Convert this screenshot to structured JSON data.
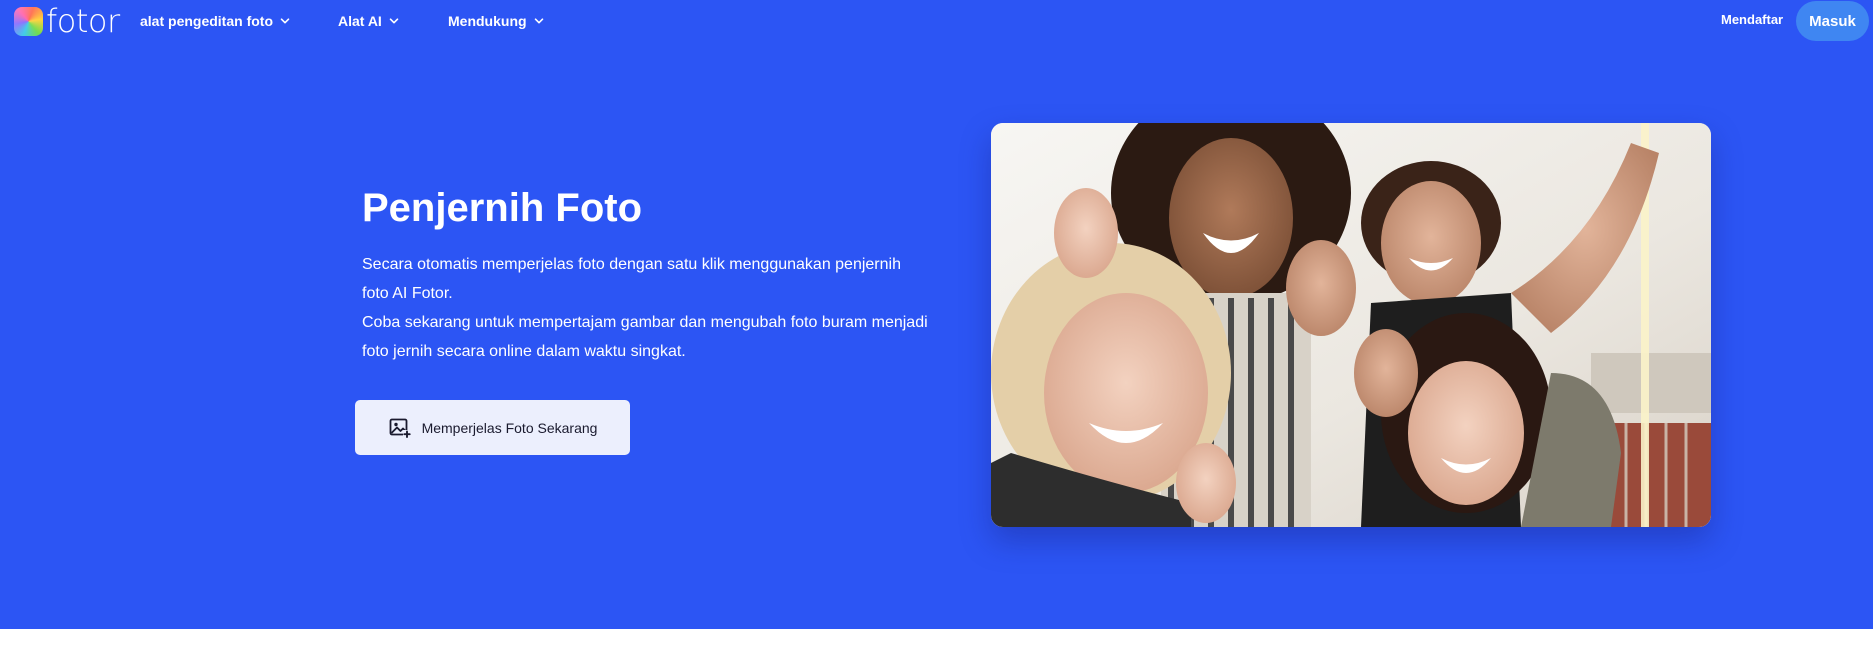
{
  "brand": {
    "name": "fotor",
    "logo_icon": "fotor-logo-icon"
  },
  "nav": {
    "items": [
      {
        "label": "alat pengeditan foto",
        "icon": "chevron-down-icon"
      },
      {
        "label": "Alat AI",
        "icon": "chevron-down-icon"
      },
      {
        "label": "Mendukung",
        "icon": "chevron-down-icon"
      }
    ],
    "signup_label": "Mendaftar",
    "login_label": "Masuk"
  },
  "hero": {
    "title": "Penjernih Foto",
    "description_1": "Secara otomatis memperjelas foto dengan satu klik menggunakan penjernih foto AI Fotor.",
    "description_2": "Coba sekarang untuk mempertajam gambar dan mengubah foto buram menjadi foto jernih secara online dalam waktu singkat.",
    "cta_label": "Memperjelas Foto Sekarang",
    "cta_icon": "add-image-icon",
    "image_icon": "group-selfie-photo"
  },
  "colors": {
    "hero_background": "#2c55f4",
    "login_button": "#3f86f2",
    "cta_background": "#eceffd",
    "text_on_hero": "#ffffff"
  }
}
